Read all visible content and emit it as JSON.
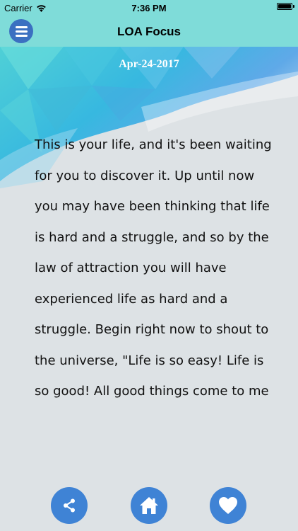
{
  "status_bar": {
    "carrier": "Carrier",
    "time": "7:36 PM",
    "battery_level": 1.0
  },
  "nav": {
    "title": "LOA Focus",
    "menu_icon": "hamburger-icon"
  },
  "content": {
    "date": "Apr-24-2017",
    "quote": "This is your life, and it's been waiting for you to discover it. Up until now you may have been thinking that life is hard and a struggle, and so by the law of attraction you will have experienced life as hard and a struggle. Begin right now to shout to the universe, \"Life is so easy! Life is so good! All good things come to me"
  },
  "bottom_buttons": [
    {
      "icon": "share-icon"
    },
    {
      "icon": "home-icon"
    },
    {
      "icon": "heart-icon"
    }
  ],
  "colors": {
    "header_bg": "#7fdcd9",
    "button_blue": "#3f83d5",
    "menu_blue": "#3b70c1",
    "background": "#dde2e5"
  }
}
